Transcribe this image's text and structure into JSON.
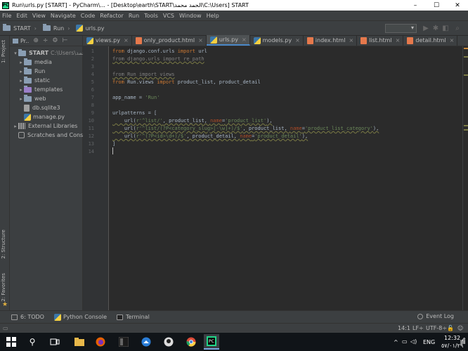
{
  "window": {
    "title": "Run\\urls.py [START] - PyCharm\\... - [Desktop\\earth\\START\\الحمد محمد\\C:\\Users] START",
    "minimize_glyph": "–",
    "maximize_glyph": "☐",
    "close_glyph": "✕"
  },
  "menu": [
    "File",
    "Edit",
    "View",
    "Navigate",
    "Code",
    "Refactor",
    "Run",
    "Tools",
    "VCS",
    "Window",
    "Help"
  ],
  "breadcrumb": {
    "items": [
      "START",
      "Run",
      "urls.py"
    ]
  },
  "project_panel": {
    "header": "Pr..",
    "root_label": "START",
    "root_path": "C:\\Users\\محمد",
    "folders": [
      "media",
      "Run",
      "static",
      "templates",
      "web"
    ],
    "files": [
      "db.sqlite3",
      "manage.py"
    ],
    "external_libraries": "External Libraries",
    "scratches": "Scratches and Console"
  },
  "left_stripe": {
    "project_tab": "1: Project",
    "structure_tab": "2: Structure",
    "favorites_tab": "2: Favorites"
  },
  "tabs": [
    {
      "label": "views.py",
      "icon": "python-file-icon"
    },
    {
      "label": "only_product.html",
      "icon": "html-file-icon"
    },
    {
      "label": "urls.py",
      "icon": "python-file-icon",
      "active": true
    },
    {
      "label": "models.py",
      "icon": "python-file-icon"
    },
    {
      "label": "index.html",
      "icon": "html-file-icon"
    },
    {
      "label": "list.html",
      "icon": "html-file-icon"
    },
    {
      "label": "detail.html",
      "icon": "html-file-icon"
    }
  ],
  "editor": {
    "line_numbers": [
      "1",
      "2",
      "3",
      "4",
      "5",
      "6",
      "7",
      "8",
      "9",
      "10",
      "11",
      "12",
      "13",
      "14"
    ],
    "code": {
      "l1_kw1": "from",
      "l1_mod": " django.conf.urls ",
      "l1_kw2": "import",
      "l1_rest": " url",
      "l2": "from django.urls import re_path",
      "l4": "from Run import views",
      "l5_kw1": "from",
      "l5_mod": " Run.views ",
      "l5_kw2": "import",
      "l5_rest": " product_list, product_detail",
      "l7_name": "app_name = ",
      "l7_str": "'Run'",
      "l9": "urlpatterns = [",
      "l10_a": "    url(",
      "l10_s1": "r'^list/'",
      "l10_b": ", product_list, ",
      "l10_p": "name",
      "l10_c": "=",
      "l10_s2": "'product_list'",
      "l10_d": "),",
      "l11_a": "    url(",
      "l11_s1": "r'^list/(?P<category_slug>[-\\w]+)/$'",
      "l11_b": ", product_list, ",
      "l11_p": "name",
      "l11_c": "=",
      "l11_s2": "'product_list_category'",
      "l11_d": "),",
      "l12_a": "    url(",
      "l12_s1": "r'^(?P<id>\\d+)/$'",
      "l12_b": ", product_detail, ",
      "l12_p": "name",
      "l12_c": "=",
      "l12_s2": "'product_detail'",
      "l12_d": "),",
      "l13": "]"
    }
  },
  "bottom_tools": {
    "todo": "6: TODO",
    "python_console": "Python Console",
    "terminal": "Terminal",
    "event_log": "Event Log"
  },
  "status": {
    "position": "14:1",
    "line_sep": "LF÷",
    "encoding": "UTF-8÷"
  },
  "taskbar": {
    "language": "ENG",
    "time": "12:32 م",
    "date": "٥٧/٠١/٢٩"
  },
  "colors": {
    "keyword": "#cc7832",
    "string": "#6a8759",
    "accent": "#4a88c7",
    "background": "#2b2b2b"
  }
}
